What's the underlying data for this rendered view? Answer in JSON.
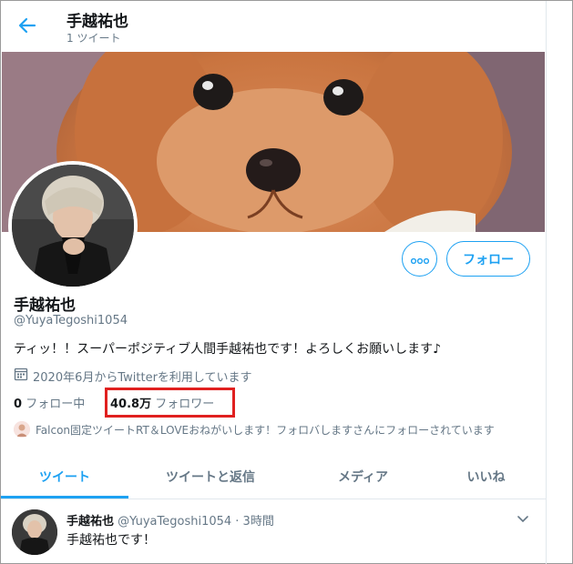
{
  "header": {
    "title": "手越祐也",
    "tweet_count": "1 ツイート"
  },
  "profile": {
    "display_name": "手越祐也",
    "handle": "@YuyaTegoshi1054",
    "bio": "ティッ！！スーパーポジティブ人間手越祐也です！よろしくお願いします♪",
    "joined": "2020年6月からTwitterを利用しています",
    "following_count": "0",
    "following_label": "フォロー中",
    "followers_count": "40.8万",
    "followers_label": "フォロワー",
    "followed_by": "Falcon固定ツイートRT＆LOVEおねがいします！フォロバしますさんにフォローされています"
  },
  "actions": {
    "more_icon": "more-dots-icon",
    "follow_label": "フォロー"
  },
  "tabs": [
    {
      "label": "ツイート",
      "active": true
    },
    {
      "label": "ツイートと返信",
      "active": false
    },
    {
      "label": "メディア",
      "active": false
    },
    {
      "label": "いいね",
      "active": false
    }
  ],
  "tweet": {
    "name": "手越祐也",
    "meta": "@YuyaTegoshi1054 · 3時間",
    "text": "手越祐也です！"
  },
  "colors": {
    "accent": "#1da1f2",
    "highlight": "#e0201f"
  }
}
